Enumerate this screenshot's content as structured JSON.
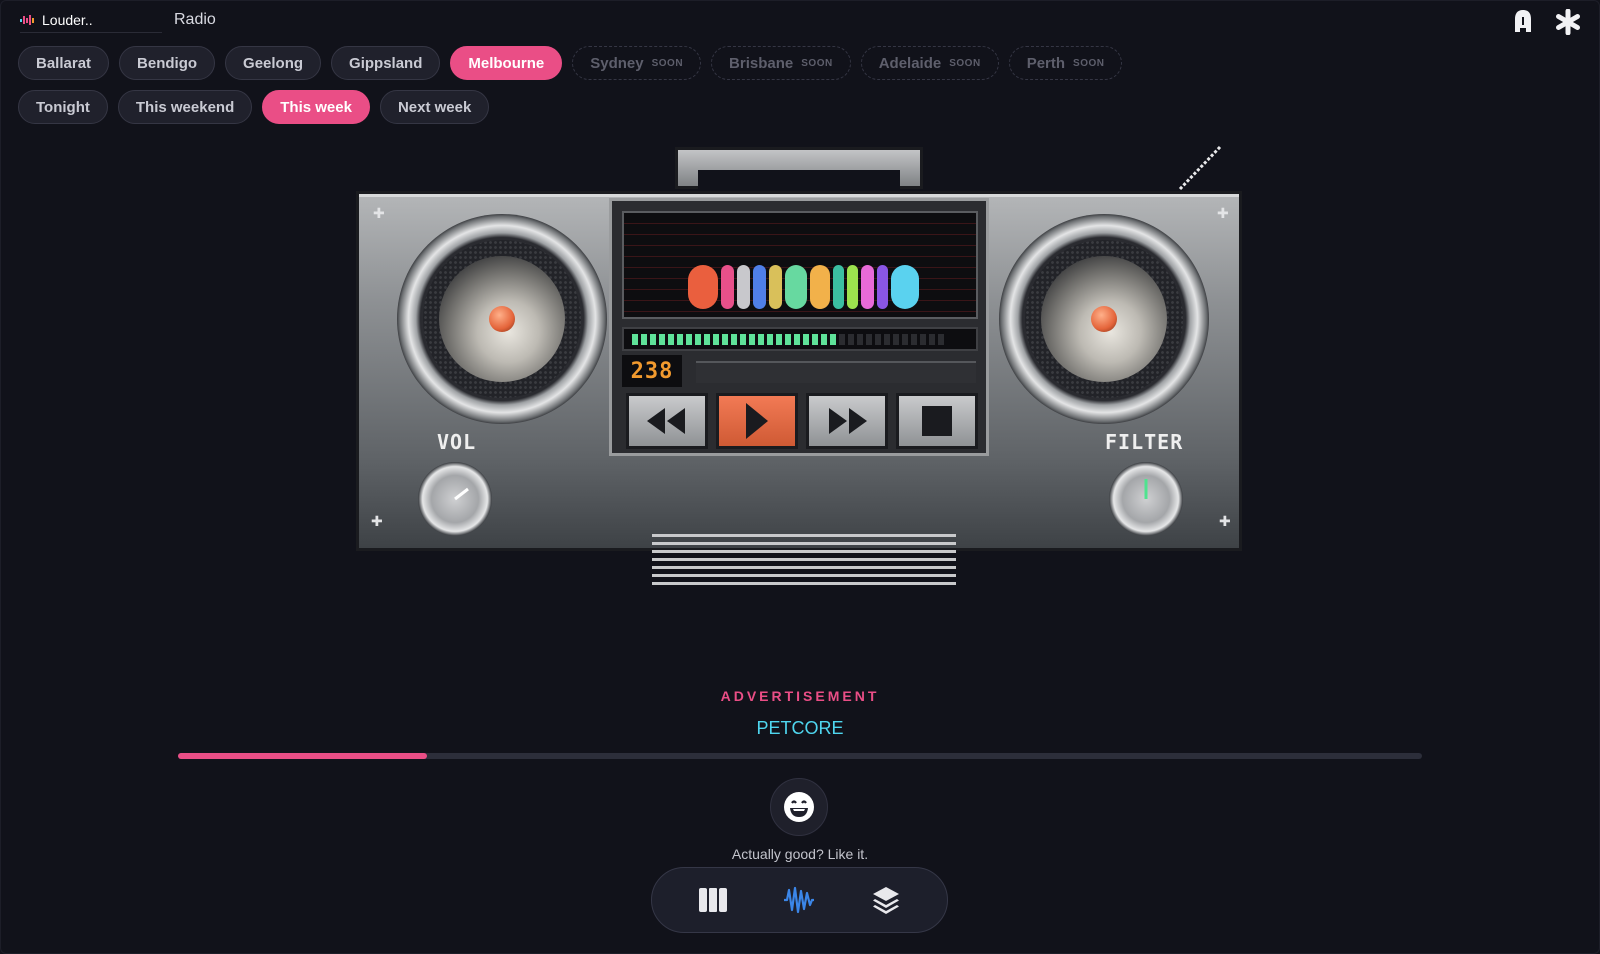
{
  "header": {
    "brand": "Louder..",
    "title": "Radio",
    "icons": [
      "notification-icon",
      "asterisk-icon"
    ]
  },
  "cities": [
    {
      "label": "Ballarat",
      "active": false,
      "soon": false
    },
    {
      "label": "Bendigo",
      "active": false,
      "soon": false
    },
    {
      "label": "Geelong",
      "active": false,
      "soon": false
    },
    {
      "label": "Gippsland",
      "active": false,
      "soon": false
    },
    {
      "label": "Melbourne",
      "active": true,
      "soon": false
    },
    {
      "label": "Sydney",
      "active": false,
      "soon": true
    },
    {
      "label": "Brisbane",
      "active": false,
      "soon": true
    },
    {
      "label": "Adelaide",
      "active": false,
      "soon": true
    },
    {
      "label": "Perth",
      "active": false,
      "soon": true
    }
  ],
  "soon_tag": "SOON",
  "timeframes": [
    {
      "label": "Tonight",
      "active": false
    },
    {
      "label": "This weekend",
      "active": false
    },
    {
      "label": "This week",
      "active": true
    },
    {
      "label": "Next week",
      "active": false
    }
  ],
  "boombox": {
    "counter": "238",
    "vol_label": "VOL",
    "filter_label": "FILTER",
    "meter_lit": 23,
    "meter_total": 35,
    "pill_colors": [
      "#ea5f3e",
      "#e8508a",
      "#c8c8cc",
      "#4f7fe8",
      "#d9c05a",
      "#67d9a0",
      "#f2b14a",
      "#3bbfa2",
      "#9ce24e",
      "#e86ad8",
      "#8a56e6",
      "#5ad2ef"
    ],
    "controls": [
      "rewind-icon",
      "play-icon",
      "fast-forward-icon",
      "stop-icon"
    ]
  },
  "ad": {
    "label": "ADVERTISEMENT",
    "name": "PETCORE",
    "progress": 0.2
  },
  "like": {
    "text": "Actually good? Like it."
  },
  "bottom_nav": [
    "map-icon",
    "waveform-icon",
    "layers-icon"
  ],
  "colors": {
    "accent": "#ea4e86",
    "cyan": "#4fd6ef",
    "background": "#11121a",
    "nav_active": "#3b86e8"
  }
}
